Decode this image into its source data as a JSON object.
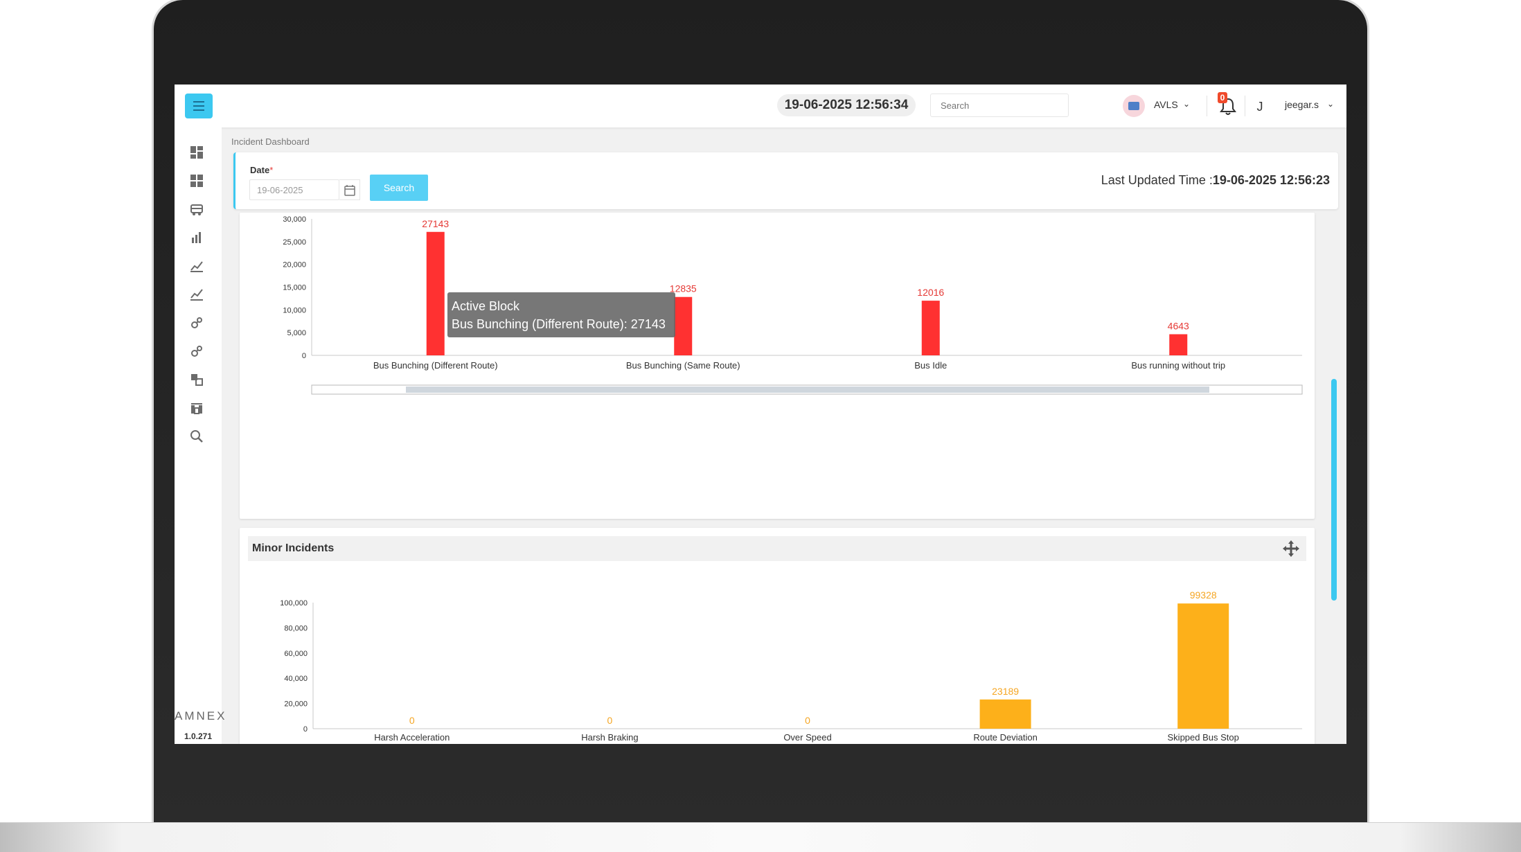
{
  "topbar": {
    "datetime": "19-06-2025 12:56:34",
    "search_placeholder": "Search",
    "app_selector": "AVLS",
    "notification_count": "0",
    "user_initial": "J",
    "user_name": "jeegar.s"
  },
  "sidebar": {
    "icons": [
      "dashboard-icon",
      "dashboard-alt-icon",
      "bus-icon",
      "bar-chart-icon",
      "line-chart-icon",
      "line-chart-alt-icon",
      "settings-link-icon",
      "settings-link-alt-icon",
      "map-pin-icon",
      "building-icon",
      "search-zoom-icon"
    ],
    "brand": "AMNEX",
    "version": "1.0.271"
  },
  "breadcrumb": "Incident Dashboard",
  "filter": {
    "date_label": "Date",
    "required_mark": "*",
    "date_value": "19-06-2025",
    "search_label": "Search",
    "last_updated_label": "Last Updated Time :",
    "last_updated_value": "19-06-2025 12:56:23"
  },
  "tooltip": {
    "line1": "Active Block",
    "line2": "Bus Bunching (Different Route): 27143"
  },
  "minor_card": {
    "title": "Minor Incidents"
  },
  "colors": {
    "accent": "#3cc8f0",
    "major": "#ff3131",
    "minor": "#fdb01a"
  },
  "chart_data": [
    {
      "type": "bar",
      "categories": [
        "Bus Bunching (Different Route)",
        "Bus Bunching (Same Route)",
        "Bus Idle",
        "Bus running without trip"
      ],
      "values": [
        27143,
        12835,
        12016,
        4643
      ],
      "ylim": [
        0,
        30000
      ],
      "yticks": [
        "0",
        "5,000",
        "10,000",
        "15,000",
        "20,000",
        "25,000",
        "30,000"
      ],
      "color": "#ff3131",
      "grid": false
    },
    {
      "type": "bar",
      "title": "Minor Incidents",
      "categories": [
        "Harsh Acceleration",
        "Harsh Braking",
        "Over Speed",
        "Route Deviation",
        "Skipped Bus Stop"
      ],
      "values": [
        0,
        0,
        0,
        23189,
        99328
      ],
      "ylim": [
        0,
        100000
      ],
      "yticks": [
        "0",
        "20,000",
        "40,000",
        "60,000",
        "80,000",
        "100,000"
      ],
      "color": "#fdb01a",
      "grid": false
    }
  ]
}
